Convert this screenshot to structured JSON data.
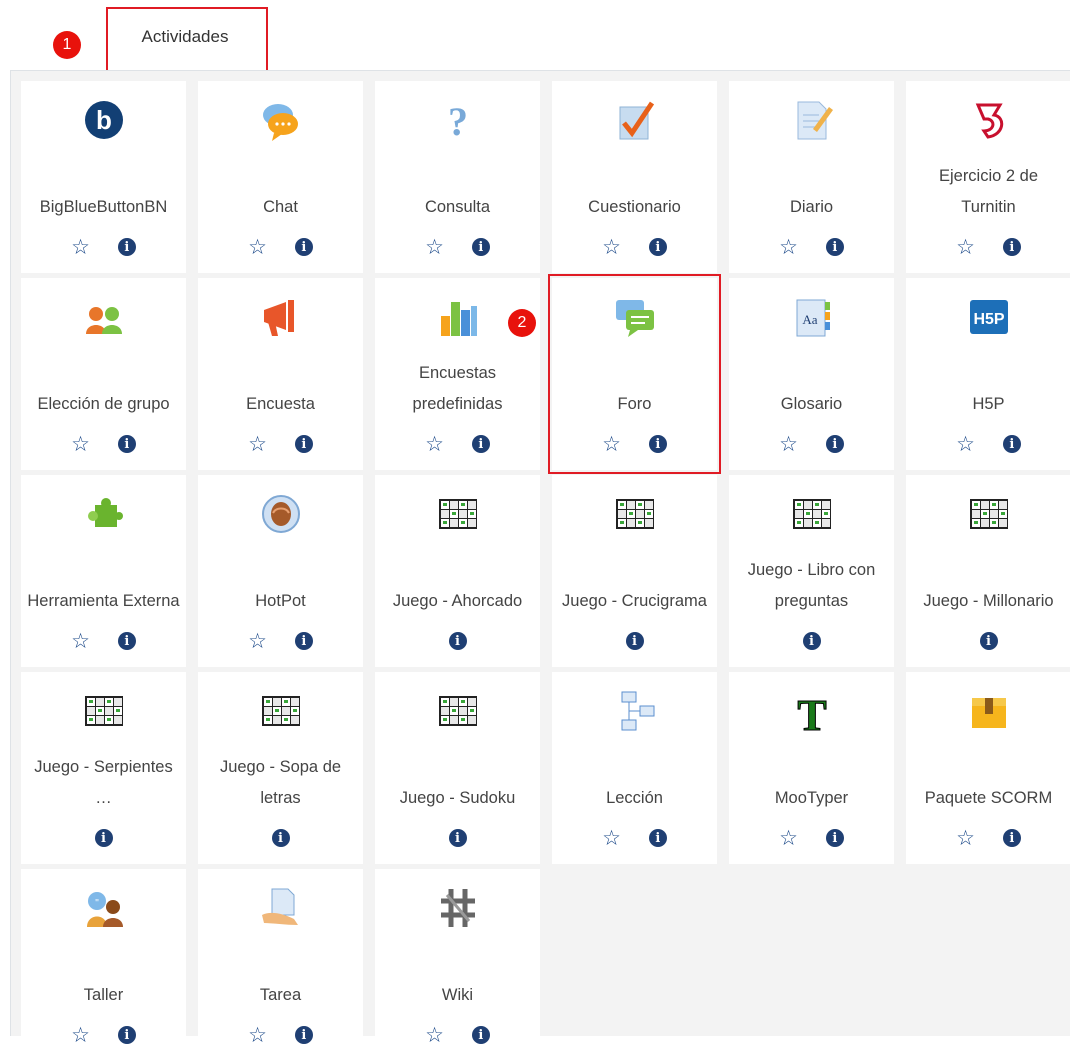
{
  "tab": {
    "label": "Actividades"
  },
  "badges": {
    "first": "1",
    "second": "2"
  },
  "tiles": [
    {
      "name": "BigBlueButtonBN",
      "icon": "bigbluebutton-icon",
      "star": true
    },
    {
      "name": "Chat",
      "icon": "chat-bubbles-icon",
      "star": true
    },
    {
      "name": "Consulta",
      "icon": "question-mark-icon",
      "star": true
    },
    {
      "name": "Cuestionario",
      "icon": "quiz-checkmark-icon",
      "star": true
    },
    {
      "name": "Diario",
      "icon": "journal-pencil-icon",
      "star": true
    },
    {
      "name": "Ejercicio 2 de Turnitin",
      "icon": "turnitin-icon",
      "star": true
    },
    {
      "name": "Elección de grupo",
      "icon": "group-choice-icon",
      "star": true
    },
    {
      "name": "Encuesta",
      "icon": "megaphone-icon",
      "star": true
    },
    {
      "name": "Encuestas predefinidas",
      "icon": "bar-chart-icon",
      "star": true
    },
    {
      "name": "Foro",
      "icon": "forum-bubbles-icon",
      "star": true
    },
    {
      "name": "Glosario",
      "icon": "glossary-book-icon",
      "star": true
    },
    {
      "name": "H5P",
      "icon": "h5p-icon",
      "star": true
    },
    {
      "name": "Herramienta Externa",
      "icon": "puzzle-piece-icon",
      "star": true
    },
    {
      "name": "HotPot",
      "icon": "hotpot-icon",
      "star": true
    },
    {
      "name": "Juego - Ahorcado",
      "icon": "game-board-icon",
      "star": false
    },
    {
      "name": "Juego - Crucigrama",
      "icon": "game-board-icon",
      "star": false
    },
    {
      "name": "Juego - Libro con preguntas",
      "icon": "game-board-icon",
      "star": false
    },
    {
      "name": "Juego - Millonario",
      "icon": "game-board-icon",
      "star": false
    },
    {
      "name": "Juego - Serpientes …",
      "icon": "game-board-icon",
      "star": false
    },
    {
      "name": "Juego - Sopa de letras",
      "icon": "game-board-icon",
      "star": false
    },
    {
      "name": "Juego - Sudoku",
      "icon": "game-board-icon",
      "star": false
    },
    {
      "name": "Lección",
      "icon": "lesson-flow-icon",
      "star": true
    },
    {
      "name": "MooTyper",
      "icon": "mootyper-t-icon",
      "star": true
    },
    {
      "name": "Paquete SCORM",
      "icon": "scorm-package-icon",
      "star": true
    },
    {
      "name": "Taller",
      "icon": "workshop-people-icon",
      "star": true
    },
    {
      "name": "Tarea",
      "icon": "assignment-hand-icon",
      "star": true
    },
    {
      "name": "Wiki",
      "icon": "wiki-icon",
      "star": true
    }
  ],
  "highlighted": "Foro"
}
